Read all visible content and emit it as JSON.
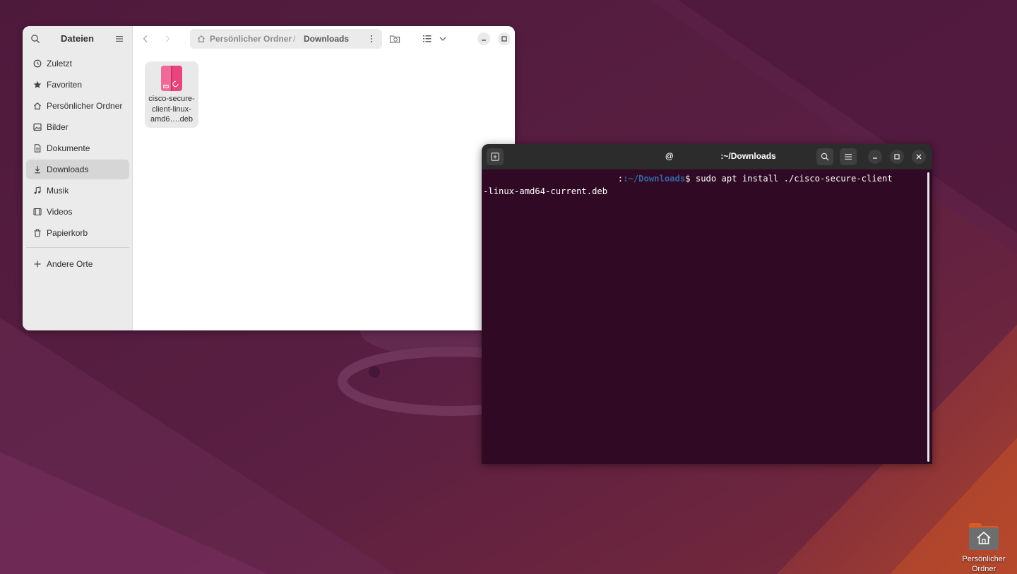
{
  "desktop": {
    "icons": [
      {
        "label": "Persönlicher Ordner"
      }
    ]
  },
  "files_window": {
    "title": "Dateien",
    "sidebar": {
      "items": [
        {
          "label": "Zuletzt",
          "icon": "clock-icon"
        },
        {
          "label": "Favoriten",
          "icon": "star-icon"
        },
        {
          "label": "Persönlicher Ordner",
          "icon": "home-icon"
        },
        {
          "label": "Bilder",
          "icon": "image-icon"
        },
        {
          "label": "Dokumente",
          "icon": "document-icon"
        },
        {
          "label": "Downloads",
          "icon": "download-icon",
          "active": true
        },
        {
          "label": "Musik",
          "icon": "music-icon"
        },
        {
          "label": "Videos",
          "icon": "video-icon"
        },
        {
          "label": "Papierkorb",
          "icon": "trash-icon"
        }
      ],
      "other_places": {
        "label": "Andere Orte",
        "icon": "plus-icon"
      }
    },
    "pathbar": {
      "crumbs": [
        "Persönlicher Ordner",
        "Downloads"
      ],
      "separator": "/"
    },
    "files": [
      {
        "name_lines": [
          "cisco-secure-",
          "client-linux-",
          "amd6….deb"
        ],
        "icon": "debian-package-icon"
      }
    ]
  },
  "terminal_window": {
    "title_at": "@",
    "title_path": ":~/Downloads",
    "lines": [
      {
        "prompt_path": ":~/Downloads",
        "prompt_symbol": "$",
        "command": " sudo apt install ./cisco-secure-client"
      },
      {
        "text": "-linux-amd64-current.deb"
      }
    ]
  },
  "colors": {
    "terminal_bg": "#300a24",
    "terminal_header": "#2c2c2c",
    "prompt_path": "#3465a4",
    "package_pink": "#e8457e"
  }
}
